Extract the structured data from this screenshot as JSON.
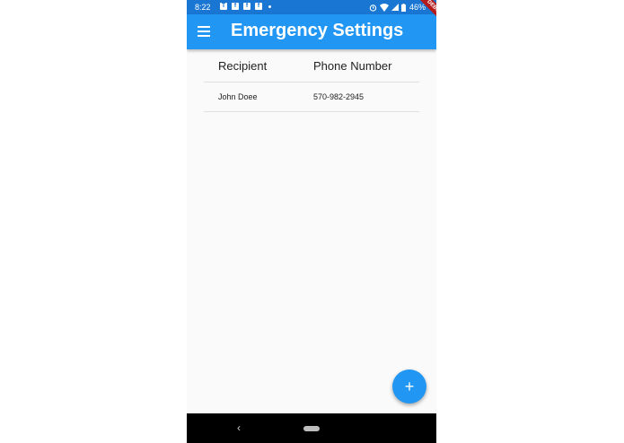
{
  "status_bar": {
    "time": "8:22",
    "notification_icons": [
      "T",
      "f",
      "f",
      "f"
    ],
    "battery": "46%"
  },
  "app_bar": {
    "title": "Emergency Settings",
    "debug_banner": "DEBUG",
    "color": "#2196f3"
  },
  "table": {
    "headers": [
      "Recipient",
      "Phone Number"
    ],
    "rows": [
      {
        "recipient": "John Doee",
        "phone": "570-982-2945"
      }
    ]
  },
  "fab": {
    "icon": "add-icon",
    "label": "+"
  },
  "nav_bar": {
    "back": "‹"
  }
}
